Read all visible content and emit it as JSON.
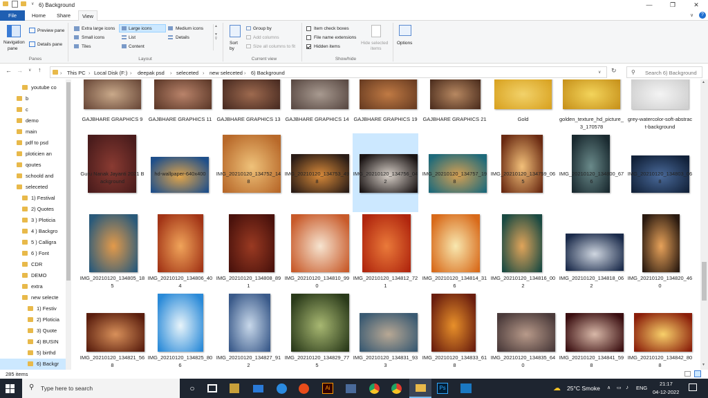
{
  "window": {
    "title": "6) Background"
  },
  "ribbon_tabs": [
    {
      "label": "File"
    },
    {
      "label": "Home"
    },
    {
      "label": "Share"
    },
    {
      "label": "View"
    }
  ],
  "ribbon": {
    "panes": {
      "navigation_pane": "Navigation",
      "navigation_pane2": "pane",
      "preview_pane": "Preview pane",
      "details_pane": "Details pane",
      "group_label": "Panes"
    },
    "layout": {
      "options": [
        "Extra large icons",
        "Large icons",
        "Medium icons",
        "Small icons",
        "List",
        "Details",
        "Tiles",
        "Content"
      ],
      "selected": "Large icons",
      "group_label": "Layout"
    },
    "current_view": {
      "sort": "Sort",
      "sort2": "by",
      "group_by": "Group by",
      "add_columns": "Add columns",
      "size_columns": "Size all columns to fit",
      "group_label": "Current view"
    },
    "show_hide": {
      "item_check_boxes": "Item check boxes",
      "file_name_extensions": "File name extensions",
      "hidden_items": "Hidden items",
      "hide_selected": "Hide selected",
      "hide_selected2": "items",
      "group_label": "Show/hide"
    },
    "options": "Options"
  },
  "address": {
    "crumbs": [
      "This PC",
      "Local Disk (F:)",
      "deepak psd",
      "seleceted",
      "new seleceted",
      "6) Background"
    ],
    "search_placeholder": "Search 6) Background"
  },
  "nav_items": [
    {
      "label": "youtube co",
      "indent": 1
    },
    {
      "label": "b",
      "indent": 0
    },
    {
      "label": "c",
      "indent": 0
    },
    {
      "label": "demo",
      "indent": 0
    },
    {
      "label": "main",
      "indent": 0
    },
    {
      "label": "pdf to psd",
      "indent": 0
    },
    {
      "label": "ploticien an",
      "indent": 0
    },
    {
      "label": "qoutes",
      "indent": 0
    },
    {
      "label": "schoold and",
      "indent": 0
    },
    {
      "label": "seleceted",
      "indent": 0
    },
    {
      "label": "1)  Festival",
      "indent": 1
    },
    {
      "label": "2)  Quotes",
      "indent": 1
    },
    {
      "label": "3 ) Ploticia",
      "indent": 1
    },
    {
      "label": "4 ) Backgro",
      "indent": 1
    },
    {
      "label": "5 ) Calligra",
      "indent": 1
    },
    {
      "label": "6 ) Font",
      "indent": 1
    },
    {
      "label": "CDR",
      "indent": 1
    },
    {
      "label": "DEMO",
      "indent": 1
    },
    {
      "label": "extra",
      "indent": 1
    },
    {
      "label": "new selecte",
      "indent": 1
    },
    {
      "label": "1)  Festiv",
      "indent": 2
    },
    {
      "label": "2) Ploticia",
      "indent": 2
    },
    {
      "label": "3)  Quote",
      "indent": 2
    },
    {
      "label": "4) BUSIN",
      "indent": 2
    },
    {
      "label": "5) birthd",
      "indent": 2
    },
    {
      "label": "6) Backgr",
      "indent": 2
    }
  ],
  "files": [
    {
      "name": "GAJBHARE GRAPHICS 9",
      "c1": "#6b4a3a",
      "c2": "#c9a98a"
    },
    {
      "name": "GAJBHARE GRAPHICS 11",
      "c1": "#5e3a2a",
      "c2": "#b9836a"
    },
    {
      "name": "GAJBHARE GRAPHICS 13",
      "c1": "#4a2c22",
      "c2": "#9e6a4f"
    },
    {
      "name": "GAJBHARE GRAPHICS 14",
      "c1": "#5a4a44",
      "c2": "#a89a90"
    },
    {
      "name": "GAJBHARE GRAPHICS 19",
      "c1": "#6a3d22",
      "c2": "#c07a44"
    },
    {
      "name": "GAJBHARE GRAPHICS 21",
      "c1": "#4e2f1f",
      "c2": "#b78861"
    },
    {
      "name": "Gold",
      "c1": "#d9a322",
      "c2": "#f2d26a"
    },
    {
      "name": "golden_texture_hd_picture_3_170578",
      "c1": "#c8931c",
      "c2": "#f3d45b"
    },
    {
      "name": "grey-watercolor-soft-abstract-background",
      "c1": "#cfcfcf",
      "c2": "#f4f4f4"
    },
    {
      "name": "Guru Nanak Jayanti 2021 Background",
      "c1": "#4a1c1c",
      "c2": "#8a3b32"
    },
    {
      "name": "hd-wallpaper-640x400",
      "c1": "#1f4f8a",
      "c2": "#e0a44a"
    },
    {
      "name": "IMG_20210120_134752_148",
      "c1": "#b8692a",
      "c2": "#efc27a"
    },
    {
      "name": "IMG_20210120_134753_498",
      "c1": "#2a1c16",
      "c2": "#d88a3a"
    },
    {
      "name": "IMG_20210120_134756_042",
      "c1": "#1a1414",
      "c2": "#d8d0c8"
    },
    {
      "name": "IMG_20210120_134757_198",
      "c1": "#1e6a7a",
      "c2": "#d7a052"
    },
    {
      "name": "IMG_20210120_134759_065",
      "c1": "#6a2a12",
      "c2": "#f2c07a"
    },
    {
      "name": "IMG_20210120_134800_676",
      "c1": "#1a2a30",
      "c2": "#6a8a8a"
    },
    {
      "name": "IMG_20210120_134803_068",
      "c1": "#12223a",
      "c2": "#4a6a9a"
    },
    {
      "name": "IMG_20210120_134805_185",
      "c1": "#2a5a7a",
      "c2": "#e39a4a"
    },
    {
      "name": "IMG_20210120_134806_404",
      "c1": "#a23416",
      "c2": "#f0a45a"
    },
    {
      "name": "IMG_20210120_134808_891",
      "c1": "#4a120c",
      "c2": "#9a3a22"
    },
    {
      "name": "IMG_20210120_134810_990",
      "c1": "#c85a2a",
      "c2": "#f6e4d0"
    },
    {
      "name": "IMG_20210120_134812_721",
      "c1": "#b0260e",
      "c2": "#ea7a3a"
    },
    {
      "name": "IMG_20210120_134814_316",
      "c1": "#d86a1a",
      "c2": "#f8e8b0"
    },
    {
      "name": "IMG_20210120_134816_002",
      "c1": "#1a4a42",
      "c2": "#e0a45a"
    },
    {
      "name": "IMG_20210120_134818_062",
      "c1": "#1a2a4a",
      "c2": "#cfd6e0"
    },
    {
      "name": "IMG_20210120_134820_460",
      "c1": "#2a1a10",
      "c2": "#e7a25a"
    },
    {
      "name": "IMG_20210120_134821_568",
      "c1": "#5a1e0e",
      "c2": "#d8905a"
    },
    {
      "name": "IMG_20210120_134825_806",
      "c1": "#2a8ad8",
      "c2": "#e8f4fa"
    },
    {
      "name": "IMG_20210120_134827_912",
      "c1": "#3a5a8a",
      "c2": "#c8d8ea"
    },
    {
      "name": "IMG_20210120_134829_775",
      "c1": "#2a3a1a",
      "c2": "#a8b872"
    },
    {
      "name": "IMG_20210120_134831_933",
      "c1": "#3a5a72",
      "c2": "#b8a894"
    },
    {
      "name": "IMG_20210120_134833_618",
      "c1": "#6a1e0e",
      "c2": "#e8902a"
    },
    {
      "name": "IMG_20210120_134835_640",
      "c1": "#4a3a3a",
      "c2": "#b89a8a"
    },
    {
      "name": "IMG_20210120_134841_598",
      "c1": "#3a0e10",
      "c2": "#d8b8a8"
    },
    {
      "name": "IMG_20210120_134842_808",
      "c1": "#8a1e0a",
      "c2": "#f8d06a"
    }
  ],
  "status": {
    "count": "285 items"
  },
  "taskbar": {
    "search_placeholder": "Type here to search",
    "weather": "25°C  Smoke",
    "lang": "ENG",
    "time": "21:17",
    "date": "04-12-2022"
  }
}
